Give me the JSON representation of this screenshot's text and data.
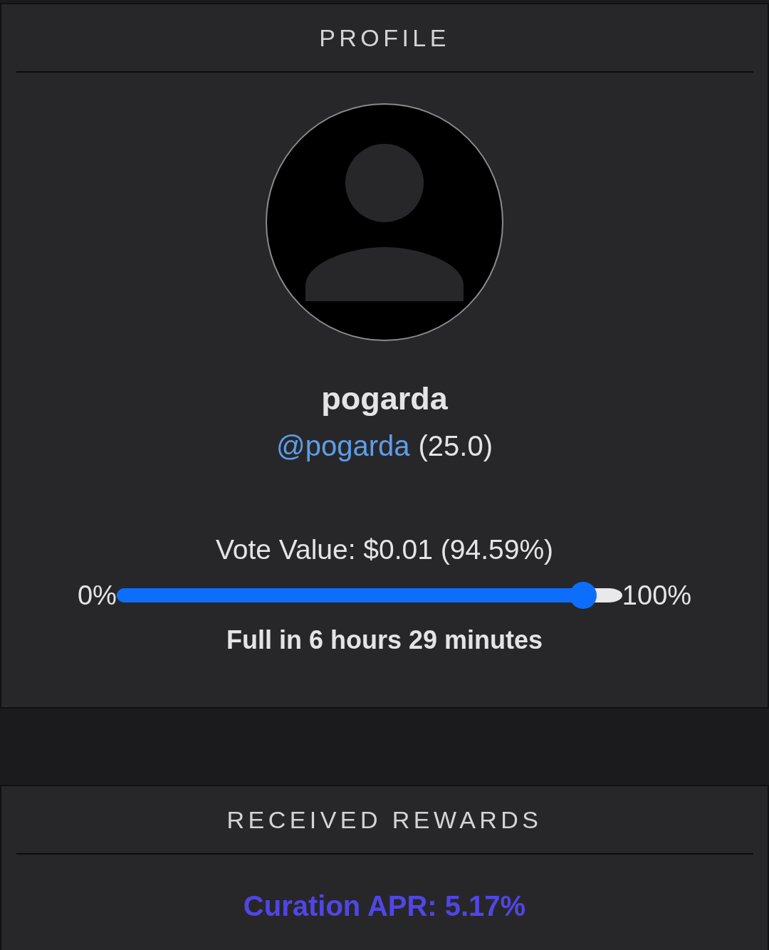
{
  "profile": {
    "title": "PROFILE",
    "display_name": "pogarda",
    "handle": "@pogarda",
    "reputation": "(25.0)",
    "vote_value": "Vote Value: $0.01 (94.59%)",
    "voting_power": {
      "min_label": "0%",
      "max_label": "100%",
      "level": 0.9459
    },
    "recharge": "Full in 6 hours 29 minutes"
  },
  "rewards": {
    "title": "RECEIVED REWARDS",
    "curation_apr": "Curation APR: 5.17%"
  }
}
